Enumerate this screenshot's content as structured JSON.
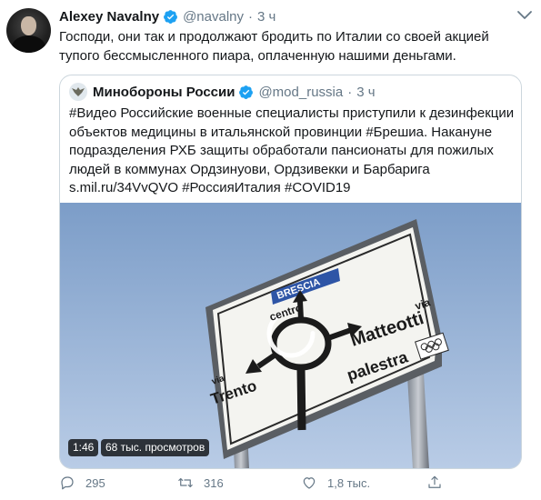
{
  "author": {
    "name": "Alexey Navalny",
    "handle": "@navalny",
    "time": "3 ч",
    "separator": "·"
  },
  "tweet_text": "Господи, они так и продолжают бродить по Италии со своей акцией тупого бессмысленного пиара, оплаченную нашими деньгами.",
  "quoted": {
    "name": "Минобороны России",
    "handle": "@mod_russia",
    "separator": "·",
    "time": "3 ч",
    "text": "#Видео Российские военные специалисты приступили к дезинфекции объектов медицины в итальянской провинции #Брешиа. Накануне подразделения РХБ защиты обработали пансионаты для пожилых людей в коммунах Ордзинуови, Ордзивекки и Барбарига s.mil.ru/34VvQVO #РоссияИталия #COVID19",
    "video": {
      "duration": "1:46",
      "views": "68 тыс. просмотров",
      "sign_texts": {
        "brescia": "BRESCIA",
        "centro": "centro",
        "via_right": "via",
        "matteotti": "Matteotti",
        "palestra": "palestra",
        "via_left": "via",
        "trento": "Trento"
      }
    }
  },
  "actions": {
    "replies": "295",
    "retweets": "316",
    "likes": "1,8 тыс."
  },
  "colors": {
    "verified": "#1da1f2",
    "secondary_text": "#657786",
    "border": "#ccd6dd"
  }
}
